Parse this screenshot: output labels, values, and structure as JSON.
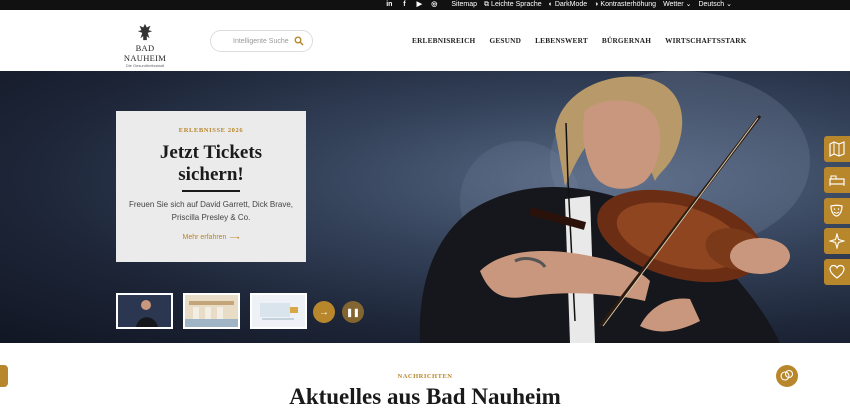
{
  "topbar": {
    "social": [
      "in",
      "f",
      "▶",
      "◎"
    ],
    "sitemap": "Sitemap",
    "easy_language": "Leichte Sprache",
    "darkmode": "DarkMode",
    "contrast": "Kontrasterhöhung",
    "weather": "Wetter",
    "language": "Deutsch"
  },
  "header": {
    "logo_name": "BAD NAUHEIM",
    "logo_tagline": "Die Gesundheitsstadt",
    "search_placeholder": "Intelligente Suche",
    "nav": [
      "ERLEBNISREICH",
      "GESUND",
      "LEBENSWERT",
      "BÜRGERNAH",
      "WIRTSCHAFTSSTARK"
    ]
  },
  "hero": {
    "eyebrow": "ERLEBNISSE 2026",
    "title_line1": "Jetzt Tickets",
    "title_line2": "sichern!",
    "text": "Freuen Sie sich auf David Garrett, Dick Brave, Priscilla Presley & Co.",
    "more_label": "Mehr erfahren",
    "more_arrow": "⟶",
    "next_symbol": "→",
    "pause_symbol": "❚❚",
    "accent_color": "#b8862b"
  },
  "side_actions": [
    "map-icon",
    "bed-icon",
    "theater-masks-icon",
    "sparkle-icon",
    "heart-icon"
  ],
  "news": {
    "label": "NACHRICHTEN",
    "title": "Aktuelles aus Bad Nauheim"
  }
}
